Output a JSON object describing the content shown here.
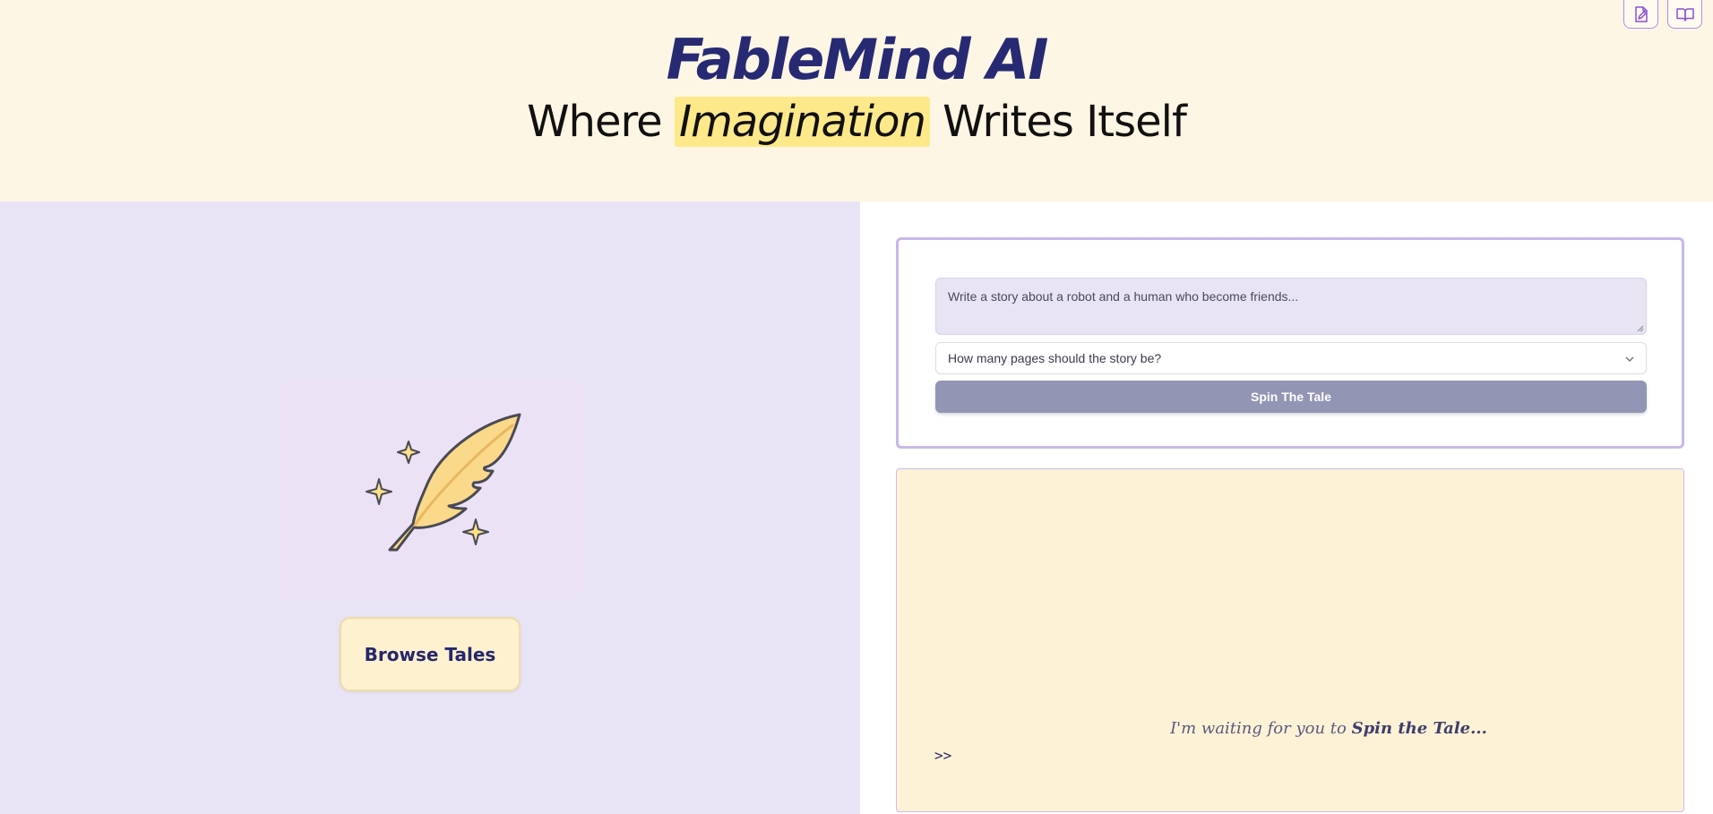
{
  "header": {
    "brand": "FableMind AI",
    "tagline_before": "Where",
    "tagline_highlight": "Imagination",
    "tagline_after": "Writes Itself",
    "icons": [
      "document-pen-icon",
      "open-book-icon"
    ]
  },
  "left_panel": {
    "illustration": "feather-quill-with-sparkles",
    "browse_label": "Browse Tales"
  },
  "form": {
    "prompt_placeholder": "Write a story about a robot and a human who become friends...",
    "pages_placeholder": "How many pages should the story be?",
    "submit_label": "Spin The Tale"
  },
  "story": {
    "waiting_text": "I'm waiting for you to",
    "waiting_emphasis": "Spin the Tale...",
    "cursor": ">>"
  },
  "colors": {
    "header_bg": "#fef6e4",
    "brand": "#272a73",
    "highlight": "#fde98a",
    "left_bg": "#e9e4f5",
    "story_bg": "#fef2d6",
    "button": "#9295b3"
  }
}
